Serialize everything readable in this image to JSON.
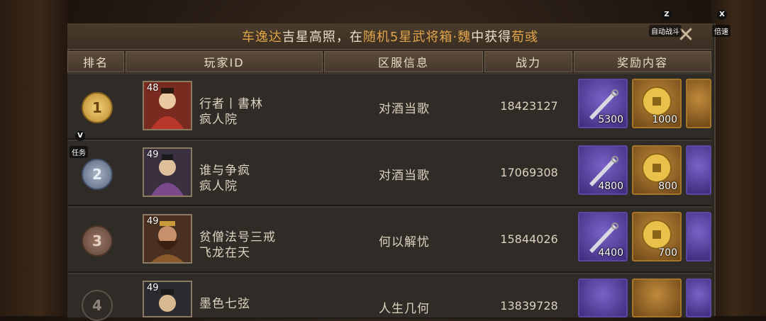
{
  "banner": {
    "p1": "车逸达",
    "p2": "吉星高照，在",
    "p3": "随机5星武将箱·魏",
    "p4": "中获得",
    "p5": "荀彧"
  },
  "headers": {
    "rank": "排名",
    "player": "玩家ID",
    "server": "区服信息",
    "power": "战力",
    "reward": "奖励内容"
  },
  "rows": [
    {
      "rank": "1",
      "level": "48",
      "name": "行者丨書林",
      "guild": "疯人院",
      "server": "对酒当歌",
      "power": "18423127",
      "rewards": [
        "5300",
        "1000",
        ""
      ]
    },
    {
      "rank": "2",
      "level": "49",
      "name": "谁与争疯",
      "guild": "疯人院",
      "server": "对酒当歌",
      "power": "17069308",
      "rewards": [
        "4800",
        "800",
        ""
      ]
    },
    {
      "rank": "3",
      "level": "49",
      "name": "贫僧法号三戒",
      "guild": "飞龙在天",
      "server": "何以解忧",
      "power": "15844026",
      "rewards": [
        "4400",
        "700",
        ""
      ]
    },
    {
      "rank": "4",
      "level": "49",
      "name": "墨色七弦",
      "guild": "",
      "server": "人生几何",
      "power": "13839728",
      "rewards": [
        "",
        "",
        ""
      ]
    }
  ],
  "overlay": {
    "z_key": "Z",
    "auto_battle": "自动战斗",
    "x_key": "X",
    "speed": "倍速",
    "v_key": "V",
    "task": "任务"
  },
  "colors": {
    "highlight": "#e0a44a",
    "panel": "#2b2722"
  }
}
